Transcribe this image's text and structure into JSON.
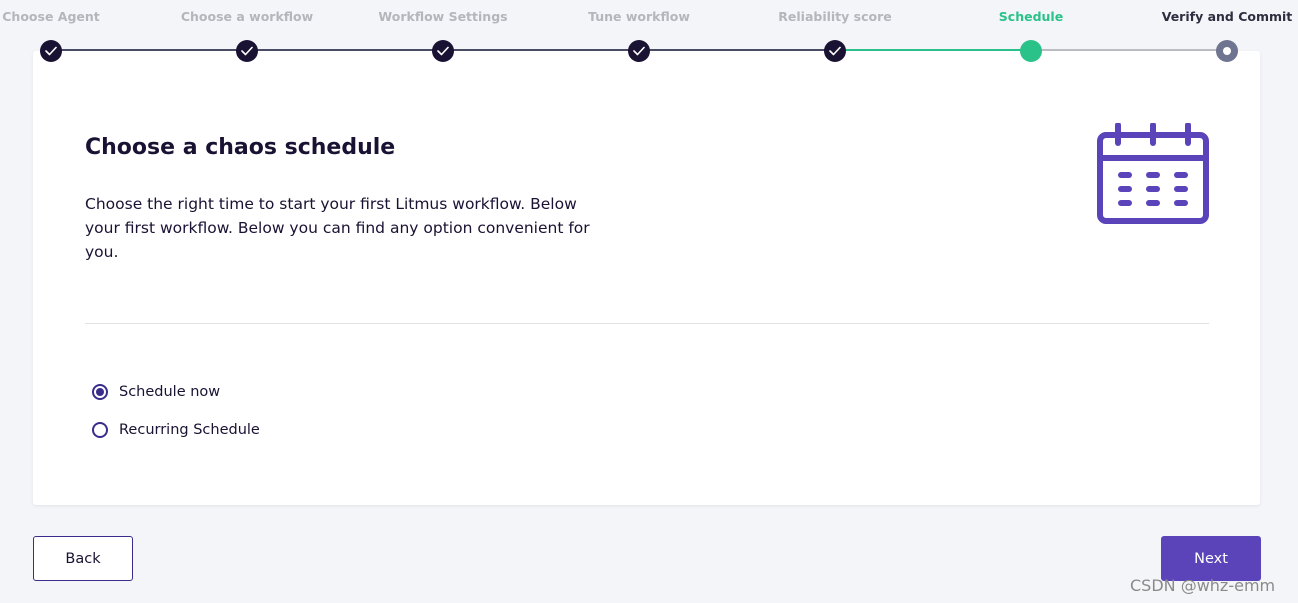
{
  "stepper": {
    "steps": [
      {
        "label": "Choose Agent",
        "state": "done"
      },
      {
        "label": "Choose a workflow",
        "state": "done"
      },
      {
        "label": "Workflow Settings",
        "state": "done"
      },
      {
        "label": "Tune workflow",
        "state": "done"
      },
      {
        "label": "Reliability score",
        "state": "done"
      },
      {
        "label": "Schedule",
        "state": "active"
      },
      {
        "label": "Verify and Commit",
        "state": "pending"
      }
    ]
  },
  "card": {
    "title": "Choose a chaos schedule",
    "description": "Choose the right time to start your first Litmus workflow. Below your first workflow. Below you can find any option convenient for you.",
    "icon": "calendar-icon",
    "options": [
      {
        "label": "Schedule now",
        "selected": true
      },
      {
        "label": "Recurring Schedule",
        "selected": false
      }
    ]
  },
  "buttons": {
    "back": "Back",
    "next": "Next"
  },
  "watermark": "CSDN @whz-emm",
  "colors": {
    "accent": "#5b44ba",
    "active_step": "#2bc28a",
    "done_step": "#1a1233",
    "pending_step": "#6f7491"
  }
}
